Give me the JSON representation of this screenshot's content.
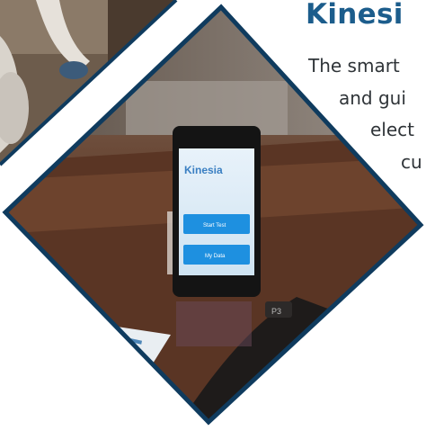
{
  "heading": "Kinesi",
  "intro_lines": [
    "The smart",
    "and gui",
    "elect",
    "cu"
  ],
  "phone": {
    "logo": "Kinesia",
    "button_1": "Start Test",
    "button_2": "My Data"
  },
  "device_tag": "P3",
  "colors": {
    "brand_blue": "#1c5d8c",
    "frame_navy": "#0f3b5e",
    "phone_button": "#1e90e0"
  }
}
